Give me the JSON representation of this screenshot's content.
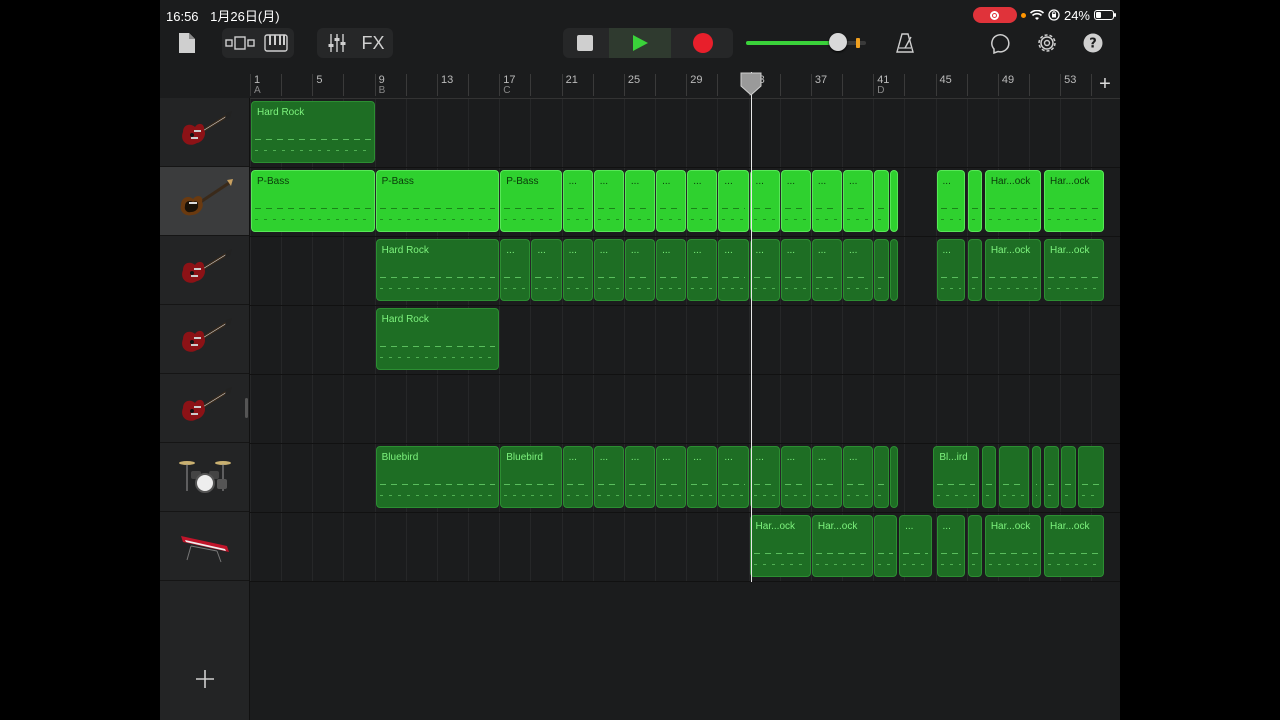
{
  "status": {
    "time": "16:56",
    "date": "1月26日(月)",
    "battery": "24%"
  },
  "toolbar": {
    "fx_label": "FX",
    "volume_level": 0.77,
    "colors": {
      "play": "#3ad23a",
      "record": "#e81f2b",
      "accent": "#3ad23a"
    }
  },
  "ruler": {
    "bars": [
      "1",
      "5",
      "9",
      "13",
      "17",
      "21",
      "25",
      "29",
      "33",
      "37",
      "41",
      "45",
      "49",
      "53"
    ],
    "sections": [
      "A",
      "B",
      "C",
      "D"
    ]
  },
  "tracks": [
    {
      "instrument": "electric-guitar-icon",
      "regions": [
        {
          "label": "Hard Rock",
          "bar_start": 1,
          "bar_end": 9,
          "style": "dark"
        }
      ]
    },
    {
      "instrument": "bass-guitar-icon",
      "selected": true,
      "regions": [
        {
          "label": "P-Bass",
          "bar_start": 1,
          "bar_end": 9,
          "style": "bright"
        },
        {
          "label": "P-Bass",
          "bar_start": 9,
          "bar_end": 17,
          "style": "bright"
        },
        {
          "label": "P-Bass",
          "bar_start": 17,
          "bar_end": 21,
          "style": "bright"
        },
        {
          "label": "...",
          "bar_start": 21,
          "bar_end": 23,
          "style": "bright"
        },
        {
          "label": "...",
          "bar_start": 23,
          "bar_end": 25,
          "style": "bright"
        },
        {
          "label": "...",
          "bar_start": 25,
          "bar_end": 27,
          "style": "bright"
        },
        {
          "label": "...",
          "bar_start": 27,
          "bar_end": 29,
          "style": "bright"
        },
        {
          "label": "...",
          "bar_start": 29,
          "bar_end": 31,
          "style": "bright"
        },
        {
          "label": "...",
          "bar_start": 31,
          "bar_end": 33,
          "style": "bright"
        },
        {
          "label": "...",
          "bar_start": 33,
          "bar_end": 35,
          "style": "bright"
        },
        {
          "label": "...",
          "bar_start": 35,
          "bar_end": 37,
          "style": "bright"
        },
        {
          "label": "...",
          "bar_start": 37,
          "bar_end": 39,
          "style": "bright"
        },
        {
          "label": "...",
          "bar_start": 39,
          "bar_end": 41,
          "style": "bright"
        },
        {
          "label": "",
          "bar_start": 41,
          "bar_end": 42,
          "style": "bright"
        },
        {
          "label": "",
          "bar_start": 42,
          "bar_end": 42.6,
          "style": "bright"
        },
        {
          "label": "...",
          "bar_start": 45,
          "bar_end": 46.9,
          "style": "bright"
        },
        {
          "label": "",
          "bar_start": 47,
          "bar_end": 48,
          "style": "bright"
        },
        {
          "label": "Har...ock",
          "bar_start": 48.1,
          "bar_end": 51.8,
          "style": "bright"
        },
        {
          "label": "Har...ock",
          "bar_start": 51.9,
          "bar_end": 55.8,
          "style": "bright"
        }
      ]
    },
    {
      "instrument": "electric-guitar-icon",
      "regions": [
        {
          "label": "Hard Rock",
          "bar_start": 9,
          "bar_end": 17,
          "style": "dark"
        },
        {
          "label": "...",
          "bar_start": 17,
          "bar_end": 19,
          "style": "dark"
        },
        {
          "label": "...",
          "bar_start": 19,
          "bar_end": 21,
          "style": "dark"
        },
        {
          "label": "...",
          "bar_start": 21,
          "bar_end": 23,
          "style": "dark"
        },
        {
          "label": "...",
          "bar_start": 23,
          "bar_end": 25,
          "style": "dark"
        },
        {
          "label": "...",
          "bar_start": 25,
          "bar_end": 27,
          "style": "dark"
        },
        {
          "label": "...",
          "bar_start": 27,
          "bar_end": 29,
          "style": "dark"
        },
        {
          "label": "...",
          "bar_start": 29,
          "bar_end": 31,
          "style": "dark"
        },
        {
          "label": "...",
          "bar_start": 31,
          "bar_end": 33,
          "style": "dark"
        },
        {
          "label": "...",
          "bar_start": 33,
          "bar_end": 35,
          "style": "dark"
        },
        {
          "label": "...",
          "bar_start": 35,
          "bar_end": 37,
          "style": "dark"
        },
        {
          "label": "...",
          "bar_start": 37,
          "bar_end": 39,
          "style": "dark"
        },
        {
          "label": "...",
          "bar_start": 39,
          "bar_end": 41,
          "style": "dark"
        },
        {
          "label": "",
          "bar_start": 41,
          "bar_end": 42,
          "style": "dark"
        },
        {
          "label": "",
          "bar_start": 42,
          "bar_end": 42.6,
          "style": "dark"
        },
        {
          "label": "...",
          "bar_start": 45,
          "bar_end": 46.9,
          "style": "dark"
        },
        {
          "label": "",
          "bar_start": 47,
          "bar_end": 48,
          "style": "dark"
        },
        {
          "label": "Har...ock",
          "bar_start": 48.1,
          "bar_end": 51.8,
          "style": "dark"
        },
        {
          "label": "Har...ock",
          "bar_start": 51.9,
          "bar_end": 55.8,
          "style": "dark"
        }
      ]
    },
    {
      "instrument": "electric-guitar-icon",
      "regions": [
        {
          "label": "Hard Rock",
          "bar_start": 9,
          "bar_end": 17,
          "style": "dark"
        }
      ]
    },
    {
      "instrument": "electric-guitar-icon",
      "regions": []
    },
    {
      "instrument": "drum-kit-icon",
      "regions": [
        {
          "label": "Bluebird",
          "bar_start": 9,
          "bar_end": 17,
          "style": "dark"
        },
        {
          "label": "Bluebird",
          "bar_start": 17,
          "bar_end": 21,
          "style": "dark"
        },
        {
          "label": "...",
          "bar_start": 21,
          "bar_end": 23,
          "style": "dark"
        },
        {
          "label": "...",
          "bar_start": 23,
          "bar_end": 25,
          "style": "dark"
        },
        {
          "label": "...",
          "bar_start": 25,
          "bar_end": 27,
          "style": "dark"
        },
        {
          "label": "...",
          "bar_start": 27,
          "bar_end": 29,
          "style": "dark"
        },
        {
          "label": "...",
          "bar_start": 29,
          "bar_end": 31,
          "style": "dark"
        },
        {
          "label": "...",
          "bar_start": 31,
          "bar_end": 33,
          "style": "dark"
        },
        {
          "label": "...",
          "bar_start": 33,
          "bar_end": 35,
          "style": "dark"
        },
        {
          "label": "...",
          "bar_start": 35,
          "bar_end": 37,
          "style": "dark"
        },
        {
          "label": "...",
          "bar_start": 37,
          "bar_end": 39,
          "style": "dark"
        },
        {
          "label": "...",
          "bar_start": 39,
          "bar_end": 41,
          "style": "dark"
        },
        {
          "label": "",
          "bar_start": 41,
          "bar_end": 42,
          "style": "dark"
        },
        {
          "label": "",
          "bar_start": 42,
          "bar_end": 42.6,
          "style": "dark"
        },
        {
          "label": "Bl...ird",
          "bar_start": 44.8,
          "bar_end": 47.8,
          "style": "dark"
        },
        {
          "label": "",
          "bar_start": 47.9,
          "bar_end": 48.9,
          "style": "dark"
        },
        {
          "label": "",
          "bar_start": 49,
          "bar_end": 51,
          "style": "dark"
        },
        {
          "label": "",
          "bar_start": 51.1,
          "bar_end": 51.8,
          "style": "dark"
        },
        {
          "label": "",
          "bar_start": 51.9,
          "bar_end": 52.9,
          "style": "dark"
        },
        {
          "label": "",
          "bar_start": 53,
          "bar_end": 54,
          "style": "dark"
        },
        {
          "label": "",
          "bar_start": 54.1,
          "bar_end": 55.8,
          "style": "dark"
        }
      ]
    },
    {
      "instrument": "keyboard-icon",
      "regions": [
        {
          "label": "Har...ock",
          "bar_start": 33,
          "bar_end": 37,
          "style": "dark"
        },
        {
          "label": "Har...ock",
          "bar_start": 37,
          "bar_end": 41,
          "style": "dark"
        },
        {
          "label": "",
          "bar_start": 41,
          "bar_end": 42.5,
          "style": "dark"
        },
        {
          "label": "...",
          "bar_start": 42.6,
          "bar_end": 44.8,
          "style": "dark"
        },
        {
          "label": "...",
          "bar_start": 45,
          "bar_end": 46.9,
          "style": "dark"
        },
        {
          "label": "",
          "bar_start": 47,
          "bar_end": 48,
          "style": "dark"
        },
        {
          "label": "Har...ock",
          "bar_start": 48.1,
          "bar_end": 51.8,
          "style": "dark"
        },
        {
          "label": "Har...ock",
          "bar_start": 51.9,
          "bar_end": 55.8,
          "style": "dark"
        }
      ]
    }
  ],
  "playhead_bar": 33
}
